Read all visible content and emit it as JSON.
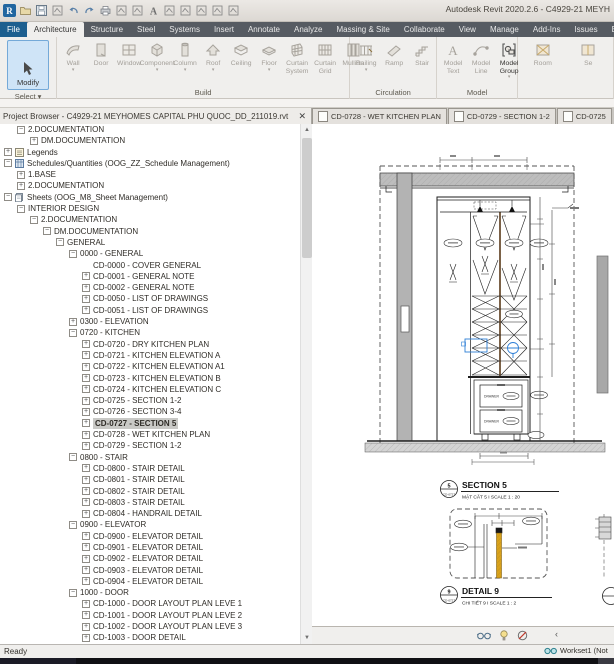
{
  "colors": {
    "selection_blue": "#2e7fd6",
    "file_tab_blue": "#1d5f8f",
    "wood_yellow": "#d9a21b",
    "selected_row_bg": "#c9c9c6"
  },
  "title_bar": {
    "app_title": "Autodesk Revit 2020.2.6 - C4929-21 MEYH",
    "qat_icons": [
      "revit-logo",
      "open-icon",
      "save-icon",
      "sync-icon",
      "undo-icon",
      "redo-icon",
      "print-icon",
      "measure-icon",
      "aligned-dimension-icon",
      "text-icon",
      "default-3d-view-icon",
      "section-icon",
      "thin-lines-icon",
      "close-hidden-windows-icon",
      "user-interface-icon"
    ]
  },
  "ribbon": {
    "tabs": [
      "File",
      "Architecture",
      "Structure",
      "Steel",
      "Systems",
      "Insert",
      "Annotate",
      "Analyze",
      "Massing & Site",
      "Collaborate",
      "View",
      "Manage",
      "Add-Ins",
      "Issues",
      "BIMomatic"
    ],
    "active_tab": "Architecture",
    "modify": {
      "label": "Modify",
      "icon": "cursor-icon"
    },
    "select_panel_label": "Select ▾",
    "panels": [
      {
        "label": "Build",
        "buttons": [
          {
            "label": "Wall",
            "icon": "wall-icon",
            "arrow": true
          },
          {
            "label": "Door",
            "icon": "door-icon"
          },
          {
            "label": "Window",
            "icon": "window-icon"
          },
          {
            "label": "Component",
            "icon": "component-icon",
            "arrow": true
          },
          {
            "label": "Column",
            "icon": "column-icon",
            "arrow": true
          },
          {
            "label": "Roof",
            "icon": "roof-icon",
            "arrow": true
          },
          {
            "label": "Ceiling",
            "icon": "ceiling-icon"
          },
          {
            "label": "Floor",
            "icon": "floor-icon",
            "arrow": true
          },
          {
            "label": "Curtain\nSystem",
            "icon": "curtain-system-icon"
          },
          {
            "label": "Curtain\nGrid",
            "icon": "curtain-grid-icon"
          },
          {
            "label": "Mullion",
            "icon": "mullion-icon"
          }
        ]
      },
      {
        "label": "Circulation",
        "buttons": [
          {
            "label": "Railing",
            "icon": "railing-icon",
            "arrow": true
          },
          {
            "label": "Ramp",
            "icon": "ramp-icon"
          },
          {
            "label": "Stair",
            "icon": "stair-icon"
          }
        ]
      },
      {
        "label": "Model",
        "buttons": [
          {
            "label": "Model\nText",
            "icon": "model-text-icon"
          },
          {
            "label": "Model\nLine",
            "icon": "model-line-icon"
          },
          {
            "label": "Model\nGroup",
            "icon": "model-group-icon",
            "arrow": true,
            "enabled": true
          }
        ]
      },
      {
        "label": "",
        "buttons": [
          {
            "label": "Room",
            "icon": "room-icon"
          },
          {
            "label": "Se",
            "icon": "room-separator-icon"
          }
        ]
      }
    ]
  },
  "project_browser": {
    "title": "Project Browser - C4929-21 MEYHOMES CAPITAL PHU QUOC_DD_211019.rvt",
    "close_glyph": "✕",
    "items": [
      {
        "label": "2.DOCUMENTATION",
        "depth": 1,
        "toggle": "minus"
      },
      {
        "label": "DM.DOCUMENTATION",
        "depth": 2,
        "toggle": "plus"
      },
      {
        "label": "Legends",
        "depth": 0,
        "toggle": "plus",
        "icon": "legends-icon"
      },
      {
        "label": "Schedules/Quantities (OOG_ZZ_Schedule Management)",
        "depth": 0,
        "toggle": "minus",
        "icon": "schedules-icon"
      },
      {
        "label": "1.BASE",
        "depth": 1,
        "toggle": "plus"
      },
      {
        "label": "2.DOCUMENTATION",
        "depth": 1,
        "toggle": "plus"
      },
      {
        "label": "Sheets (OOG_M8_Sheet Management)",
        "depth": 0,
        "toggle": "minus",
        "icon": "sheets-icon"
      },
      {
        "label": "INTERIOR DESIGN",
        "depth": 1,
        "toggle": "minus"
      },
      {
        "label": "2.DOCUMENTATION",
        "depth": 2,
        "toggle": "minus"
      },
      {
        "label": "DM.DOCUMENTATION",
        "depth": 3,
        "toggle": "minus"
      },
      {
        "label": "GENERAL",
        "depth": 4,
        "toggle": "minus"
      },
      {
        "label": "0000 - GENERAL",
        "depth": 5,
        "toggle": "minus"
      },
      {
        "label": "CD-0000 - COVER GENERAL",
        "depth": 6,
        "toggle": "none"
      },
      {
        "label": "CD-0001 - GENERAL NOTE",
        "depth": 6,
        "toggle": "plus"
      },
      {
        "label": "CD-0002 - GENERAL NOTE",
        "depth": 6,
        "toggle": "plus"
      },
      {
        "label": "CD-0050 - LIST OF DRAWINGS",
        "depth": 6,
        "toggle": "plus"
      },
      {
        "label": "CD-0051 - LIST OF DRAWINGS",
        "depth": 6,
        "toggle": "plus"
      },
      {
        "label": "0300 - ELEVATION",
        "depth": 5,
        "toggle": "plus"
      },
      {
        "label": "0720 - KITCHEN",
        "depth": 5,
        "toggle": "minus"
      },
      {
        "label": "CD-0720 - DRY KITCHEN PLAN",
        "depth": 6,
        "toggle": "plus"
      },
      {
        "label": "CD-0721 - KITCHEN ELEVATION A",
        "depth": 6,
        "toggle": "plus"
      },
      {
        "label": "CD-0722 - KITCHEN ELEVATION A1",
        "depth": 6,
        "toggle": "plus"
      },
      {
        "label": "CD-0723 - KITCHEN ELEVATION B",
        "depth": 6,
        "toggle": "plus"
      },
      {
        "label": "CD-0724 - KITCHEN ELEVATION C",
        "depth": 6,
        "toggle": "plus"
      },
      {
        "label": "CD-0725 - SECTION 1-2",
        "depth": 6,
        "toggle": "plus"
      },
      {
        "label": "CD-0726 - SECTION 3-4",
        "depth": 6,
        "toggle": "plus"
      },
      {
        "label": "CD-0727 - SECTION 5",
        "depth": 6,
        "toggle": "plus",
        "selected": true
      },
      {
        "label": "CD-0728 - WET KITCHEN PLAN",
        "depth": 6,
        "toggle": "plus"
      },
      {
        "label": "CD-0729 - SECTION 1-2",
        "depth": 6,
        "toggle": "plus"
      },
      {
        "label": "0800 - STAIR",
        "depth": 5,
        "toggle": "minus"
      },
      {
        "label": "CD-0800 - STAIR DETAIL",
        "depth": 6,
        "toggle": "plus"
      },
      {
        "label": "CD-0801 - STAIR DETAIL",
        "depth": 6,
        "toggle": "plus"
      },
      {
        "label": "CD-0802 - STAIR DETAIL",
        "depth": 6,
        "toggle": "plus"
      },
      {
        "label": "CD-0803 - STAIR DETAIL",
        "depth": 6,
        "toggle": "plus"
      },
      {
        "label": "CD-0804 - HANDRAIL DETAIL",
        "depth": 6,
        "toggle": "plus"
      },
      {
        "label": "0900 - ELEVATOR",
        "depth": 5,
        "toggle": "minus"
      },
      {
        "label": "CD-0900 - ELEVATOR  DETAIL",
        "depth": 6,
        "toggle": "plus"
      },
      {
        "label": "CD-0901 - ELEVATOR  DETAIL",
        "depth": 6,
        "toggle": "plus"
      },
      {
        "label": "CD-0902 - ELEVATOR  DETAIL",
        "depth": 6,
        "toggle": "plus"
      },
      {
        "label": "CD-0903 - ELEVATOR  DETAIL",
        "depth": 6,
        "toggle": "plus"
      },
      {
        "label": "CD-0904 - ELEVATOR  DETAIL",
        "depth": 6,
        "toggle": "plus"
      },
      {
        "label": "1000 - DOOR",
        "depth": 5,
        "toggle": "minus"
      },
      {
        "label": "CD-1000 - DOOR LAYOUT PLAN LEVE 1",
        "depth": 6,
        "toggle": "plus"
      },
      {
        "label": "CD-1001 - DOOR LAYOUT PLAN LEVE 2",
        "depth": 6,
        "toggle": "plus"
      },
      {
        "label": "CD-1002 - DOOR LAYOUT PLAN LEVE 3",
        "depth": 6,
        "toggle": "plus"
      },
      {
        "label": "CD-1003 - DOOR DETAIL",
        "depth": 6,
        "toggle": "plus"
      }
    ]
  },
  "view_tabs": [
    {
      "label": "CD-0728 - WET KITCHEN PLAN"
    },
    {
      "label": "CD-0729 - SECTION 1-2"
    },
    {
      "label": "CD-0725"
    }
  ],
  "drawing": {
    "section": {
      "bubble_number": "5",
      "bubble_ref": "CD-0727",
      "title": "SECTION 5",
      "subtitle": "MẶT CẮT 5 I SCALE  1 : 20"
    },
    "detail": {
      "bubble_number": "9",
      "bubble_ref": "CD-0727",
      "title": "DETAIL 9",
      "subtitle": "CHI TIẾT 9 I SCALE  1 : 2"
    },
    "drawer_label_1": "DRAWER",
    "drawer_label_2": "DRAWER"
  },
  "status_bar": {
    "ready": "Ready",
    "workset": "Workset1 (Not"
  }
}
